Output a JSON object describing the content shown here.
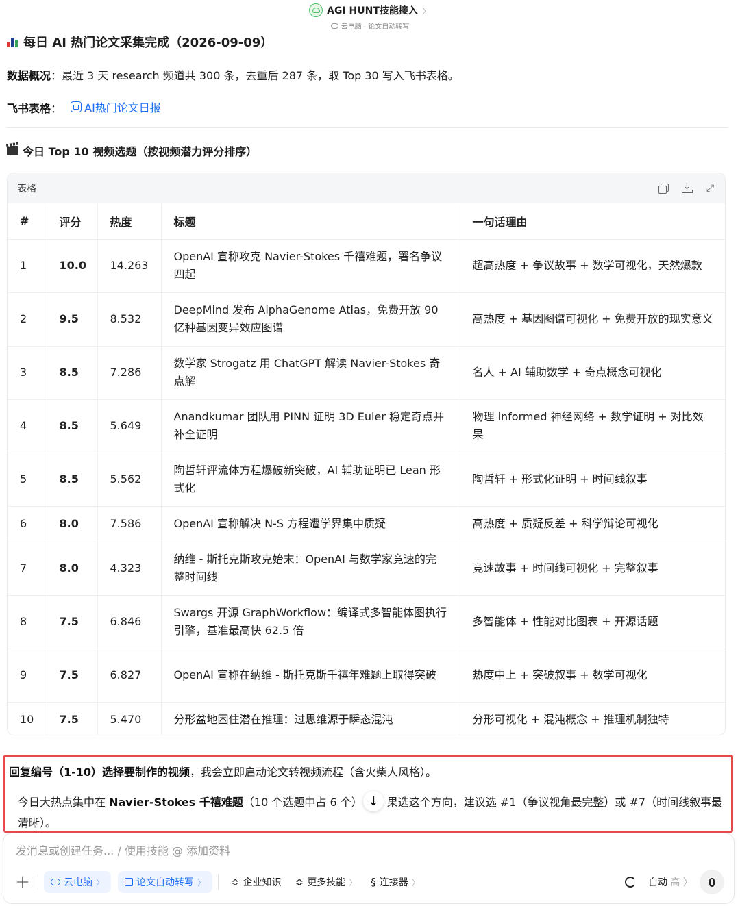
{
  "header": {
    "app_title": "AGI HUNT技能接入",
    "chevron": "〉",
    "subtitle": "云电脑 · 论文自动转写"
  },
  "report": {
    "heading": "每日 AI 热门论文采集完成（2026-09-09）",
    "overview_label": "数据概况",
    "overview_text": "：最近 3 天 research 频道共 300 条，去重后 287 条，取 Top 30 写入飞书表格。",
    "sheet_label": "飞书表格",
    "sheet_colon": "：",
    "sheet_link": "AI热门论文日报",
    "section_title": "今日 Top 10 视频选题（按视频潜力评分排序）"
  },
  "table_card": {
    "label": "表格",
    "columns": [
      "#",
      "评分",
      "热度",
      "标题",
      "一句话理由"
    ],
    "rows": [
      {
        "n": "1",
        "score": "10.0",
        "heat": "14.263",
        "title": "OpenAI 宣称攻克 Navier-Stokes 千禧难题，署名争议四起",
        "reason": "超高热度 + 争议故事 + 数学可视化，天然爆款"
      },
      {
        "n": "2",
        "score": "9.5",
        "heat": "8.532",
        "title": "DeepMind 发布 AlphaGenome Atlas，免费开放 90 亿种基因变异效应图谱",
        "reason": "高热度 + 基因图谱可视化 + 免费开放的现实意义"
      },
      {
        "n": "3",
        "score": "8.5",
        "heat": "7.286",
        "title": "数学家 Strogatz 用 ChatGPT 解读 Navier-Stokes 奇点解",
        "reason": "名人 + AI 辅助数学 + 奇点概念可视化"
      },
      {
        "n": "4",
        "score": "8.5",
        "heat": "5.649",
        "title": "Anandkumar 团队用 PINN 证明 3D Euler 稳定奇点并补全证明",
        "reason": "物理 informed 神经网络 + 数学证明 + 对比效果"
      },
      {
        "n": "5",
        "score": "8.5",
        "heat": "5.562",
        "title": "陶哲轩评流体方程爆破新突破，AI 辅助证明已 Lean 形式化",
        "reason": "陶哲轩 + 形式化证明 + 时间线叙事"
      },
      {
        "n": "6",
        "score": "8.0",
        "heat": "7.586",
        "title": "OpenAI 宣称解决 N-S 方程遭学界集中质疑",
        "reason": "高热度 + 质疑反差 + 科学辩论可视化"
      },
      {
        "n": "7",
        "score": "8.0",
        "heat": "4.323",
        "title": "纳维 - 斯托克斯攻克始末：OpenAI 与数学家竞速的完整时间线",
        "reason": "竞速故事 + 时间线可视化 + 完整叙事"
      },
      {
        "n": "8",
        "score": "7.5",
        "heat": "6.846",
        "title": "Swargs 开源 GraphWorkflow：编译式多智能体图执行引擎，基准最高快 62.5 倍",
        "reason": "多智能体 + 性能对比图表 + 开源话题"
      },
      {
        "n": "9",
        "score": "7.5",
        "heat": "6.827",
        "title": "OpenAI 宣称在纳维 - 斯托克斯千禧年难题上取得突破",
        "reason": "热度中上 + 突破叙事 + 数学可视化"
      },
      {
        "n": "10",
        "score": "7.5",
        "heat": "5.470",
        "title": "分形盆地困住潜在推理：过思维源于瞬态混沌",
        "reason": "分形可视化 + 混沌概念 + 推理机制独特"
      }
    ]
  },
  "reply": {
    "line1_bold": "回复编号（1-10）选择要制作的视频",
    "line1_rest": "，我会立即启动论文转视频流程（含火柴人风格）。",
    "line2_pre": "今日大热点集中在 ",
    "line2_bold": "Navier-Stokes 千禧难题",
    "line2_mid": "（10 个选题中占 6 个）",
    "line2_post": "果选这个方向，建议选 #1（争议视角最完整）或 #7（时间线叙事最清晰）。",
    "scroll_arrow": "↓"
  },
  "composer": {
    "placeholder": "发消息或创建任务... / 使用技能 @ 添加资料",
    "plus": "+",
    "chip_cloud": "云电脑",
    "chip_paper": "论文自动转写",
    "chip_knowledge": "企业知识",
    "chip_skills": "更多技能",
    "chip_connector": "连接器",
    "mode_label": "自动",
    "mode_level": "高",
    "chevron": "〉"
  }
}
